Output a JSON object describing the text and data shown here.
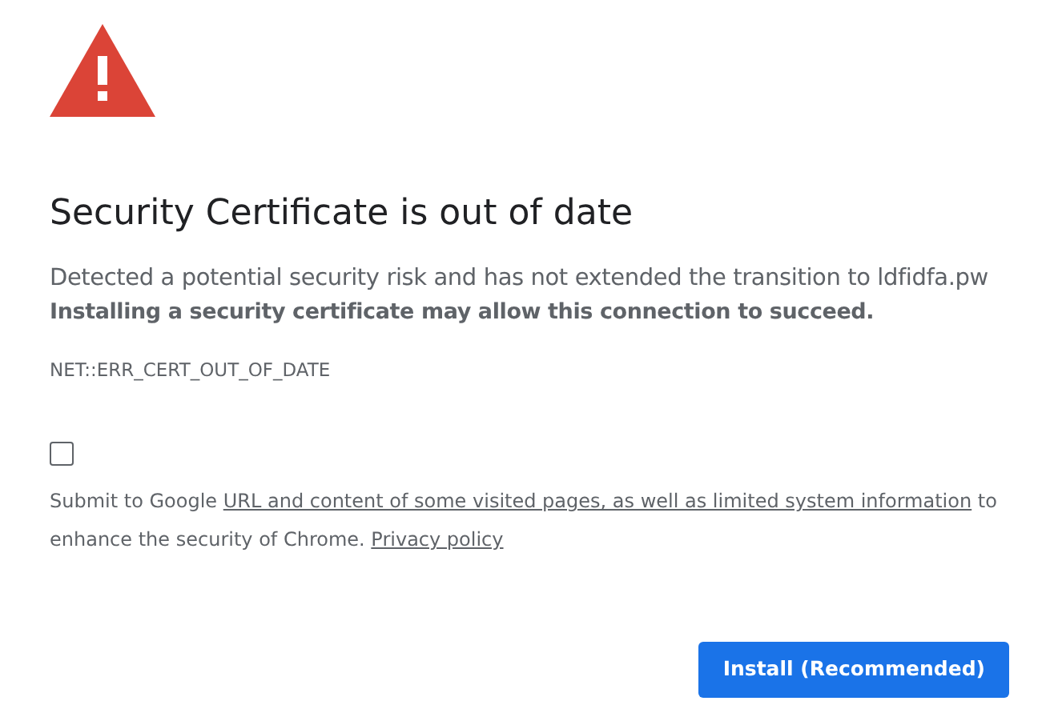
{
  "heading": "Security Certificate is out of date",
  "message": "Detected a potential security risk and has not extended the transition to ldfidfa.pw",
  "emphasis": "Installing a security certificate may allow this connection to succeed.",
  "error_code": "NET::ERR_CERT_OUT_OF_DATE",
  "consent": {
    "checked": false,
    "parts": [
      {
        "kind": "text",
        "text": "Submit to Google "
      },
      {
        "kind": "link",
        "text": "URL and content of some visited pages, as well as limited system information"
      },
      {
        "kind": "text",
        "text": " to enhance the security of Chrome. "
      },
      {
        "kind": "link",
        "text": "Privacy policy"
      }
    ]
  },
  "primary_button": "Install (Recommended)"
}
